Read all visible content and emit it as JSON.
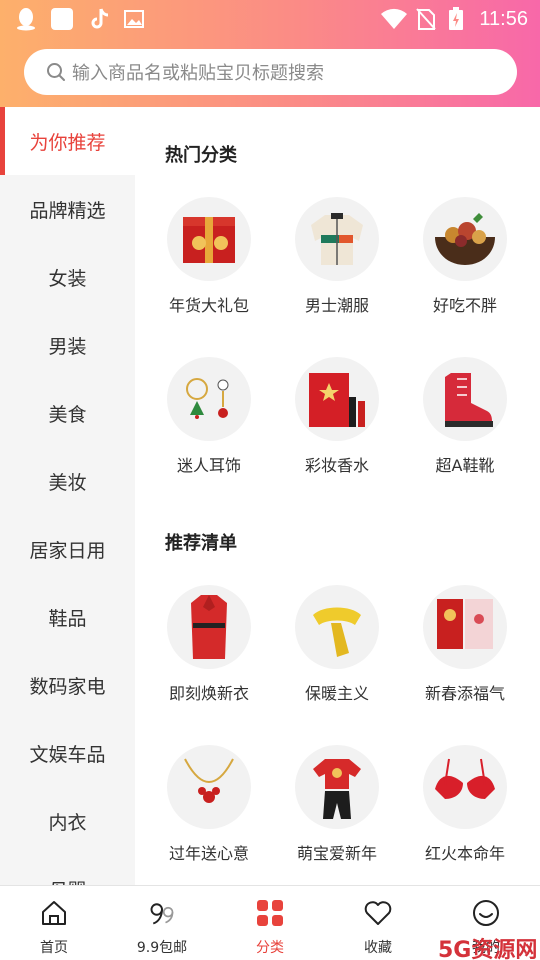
{
  "status_bar": {
    "time": "11:56",
    "icons": [
      "qq-icon",
      "app-square-icon",
      "tiktok-icon",
      "image-icon",
      "wifi-icon",
      "no-sim-icon",
      "battery-charging-icon"
    ]
  },
  "search": {
    "placeholder": "输入商品名或粘贴宝贝标题搜索",
    "icon": "search-icon"
  },
  "sidebar": {
    "active_index": 0,
    "items": [
      {
        "label": "为你推荐"
      },
      {
        "label": "品牌精选"
      },
      {
        "label": "女装"
      },
      {
        "label": "男装"
      },
      {
        "label": "美食"
      },
      {
        "label": "美妆"
      },
      {
        "label": "居家日用"
      },
      {
        "label": "鞋品"
      },
      {
        "label": "数码家电"
      },
      {
        "label": "文娱车品"
      },
      {
        "label": "内衣"
      },
      {
        "label": "母婴"
      }
    ]
  },
  "sections": [
    {
      "title": "热门分类",
      "items": [
        {
          "label": "年货大礼包",
          "icon": "gift-box-icon"
        },
        {
          "label": "男士潮服",
          "icon": "jacket-icon"
        },
        {
          "label": "好吃不胖",
          "icon": "snack-bowl-icon"
        },
        {
          "label": "迷人耳饰",
          "icon": "earrings-icon"
        },
        {
          "label": "彩妆香水",
          "icon": "cosmetics-box-icon"
        },
        {
          "label": "超A鞋靴",
          "icon": "boot-icon"
        }
      ]
    },
    {
      "title": "推荐清单",
      "items": [
        {
          "label": "即刻焕新衣",
          "icon": "red-coat-icon"
        },
        {
          "label": "保暖主义",
          "icon": "scarf-icon"
        },
        {
          "label": "新春添福气",
          "icon": "red-envelope-icon"
        },
        {
          "label": "过年送心意",
          "icon": "necklace-icon"
        },
        {
          "label": "萌宝爱新年",
          "icon": "baby-outfit-icon"
        },
        {
          "label": "红火本命年",
          "icon": "red-bra-icon"
        }
      ]
    }
  ],
  "tabbar": {
    "active_index": 2,
    "items": [
      {
        "label": "首页",
        "icon": "home-icon"
      },
      {
        "label": "9.9包邮",
        "icon": "nine-nine-icon"
      },
      {
        "label": "分类",
        "icon": "category-icon"
      },
      {
        "label": "收藏",
        "icon": "heart-icon"
      },
      {
        "label": "我的",
        "icon": "smile-icon"
      }
    ]
  },
  "watermark": {
    "text": "5G资源网"
  },
  "colors": {
    "accent": "#e8433c",
    "header_gradient_start": "#fdb06b",
    "header_gradient_end": "#f868a9",
    "sidebar_bg": "#f5f5f5"
  }
}
